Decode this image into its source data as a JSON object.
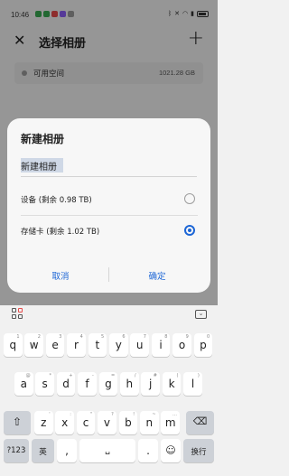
{
  "status_bar": {
    "time": "10:46"
  },
  "app_bar": {
    "title": "选择相册",
    "close_icon": "close-icon",
    "add_icon": "plus-icon"
  },
  "storage": {
    "label": "可用空间",
    "size": "1021.28 GB"
  },
  "dialog": {
    "title": "新建相册",
    "name_value": "新建相册",
    "options": [
      {
        "label": "设备 (剩余 0.98 TB)",
        "selected": false
      },
      {
        "label": "存储卡 (剩余 1.02 TB)",
        "selected": true
      }
    ],
    "cancel_label": "取消",
    "confirm_label": "确定",
    "accent": "#1d66d6"
  },
  "keyboard": {
    "row1": [
      {
        "key": "q",
        "sub": "1"
      },
      {
        "key": "w",
        "sub": "2"
      },
      {
        "key": "e",
        "sub": "3"
      },
      {
        "key": "r",
        "sub": "4"
      },
      {
        "key": "t",
        "sub": "5"
      },
      {
        "key": "y",
        "sub": "6"
      },
      {
        "key": "u",
        "sub": "7"
      },
      {
        "key": "i",
        "sub": "8"
      },
      {
        "key": "o",
        "sub": "9"
      },
      {
        "key": "p",
        "sub": "0"
      }
    ],
    "row2": [
      {
        "key": "a",
        "sub": "@"
      },
      {
        "key": "s",
        "sub": "*"
      },
      {
        "key": "d",
        "sub": "+"
      },
      {
        "key": "f",
        "sub": "-"
      },
      {
        "key": "g",
        "sub": "="
      },
      {
        "key": "h",
        "sub": "/"
      },
      {
        "key": "j",
        "sub": "#"
      },
      {
        "key": "k",
        "sub": "("
      },
      {
        "key": "l",
        "sub": ")"
      }
    ],
    "row3": [
      {
        "key": "z",
        "sub": "'"
      },
      {
        "key": "x",
        "sub": ":"
      },
      {
        "key": "c",
        "sub": "\""
      },
      {
        "key": "v",
        "sub": "?"
      },
      {
        "key": "b",
        "sub": "!"
      },
      {
        "key": "n",
        "sub": "~"
      },
      {
        "key": "m",
        "sub": "…"
      }
    ],
    "symbols_label": "?123",
    "lang_label": "英",
    "comma_label": ",",
    "period_label": ".",
    "emoji_icon": "emoji-icon",
    "enter_label": "换行"
  }
}
